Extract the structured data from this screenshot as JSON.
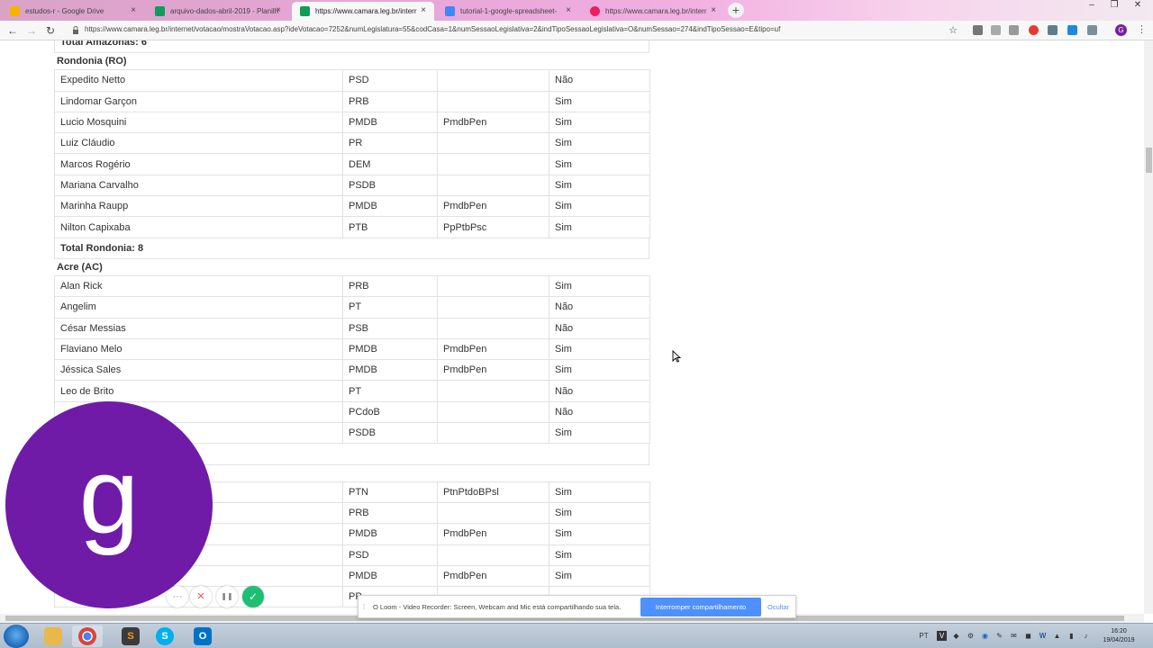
{
  "tabs": [
    {
      "label": "estudos-r - Google Drive",
      "favicon_color": "#f4b400"
    },
    {
      "label": "arquivo-dados-abril-2019 - Planilhas",
      "favicon_color": "#0f9d58"
    },
    {
      "label": "https://www.camara.leg.br/interr",
      "favicon_color": "#0f9d58"
    },
    {
      "label": "tutorial-1-google-spreadsheet-",
      "favicon_color": "#4285f4"
    },
    {
      "label": "https://www.camara.leg.br/interr",
      "favicon_color": "#e91e63"
    }
  ],
  "new_tab_symbol": "+",
  "address_bar": {
    "url": "https://www.camara.leg.br/internet/votacao/mostraVotacao.asp?ideVotacao=7252&numLegislatura=55&codCasa=1&numSessaoLegislativa=2&indTipoSessaoLegislativa=O&numSessao=274&indTipoSessao=E&tipo=uf"
  },
  "profile_initial": "G",
  "page": {
    "total_amazonas": "Total Amazonas: 6",
    "states": [
      {
        "header": "Rondonia (RO)",
        "rows": [
          {
            "name": "Expedito Netto",
            "party": "PSD",
            "bloc": "",
            "vote": "Não"
          },
          {
            "name": "Lindomar Garçon",
            "party": "PRB",
            "bloc": "",
            "vote": "Sim"
          },
          {
            "name": "Lucio Mosquini",
            "party": "PMDB",
            "bloc": "PmdbPen",
            "vote": "Sim"
          },
          {
            "name": "Luiz Cláudio",
            "party": "PR",
            "bloc": "",
            "vote": "Sim"
          },
          {
            "name": "Marcos Rogério",
            "party": "DEM",
            "bloc": "",
            "vote": "Sim"
          },
          {
            "name": "Mariana Carvalho",
            "party": "PSDB",
            "bloc": "",
            "vote": "Sim"
          },
          {
            "name": "Marinha Raupp",
            "party": "PMDB",
            "bloc": "PmdbPen",
            "vote": "Sim"
          },
          {
            "name": "Nilton Capixaba",
            "party": "PTB",
            "bloc": "PpPtbPsc",
            "vote": "Sim"
          }
        ],
        "total": "Total Rondonia: 8"
      },
      {
        "header": "Acre (AC)",
        "rows": [
          {
            "name": "Alan Rick",
            "party": "PRB",
            "bloc": "",
            "vote": "Sim"
          },
          {
            "name": "Angelim",
            "party": "PT",
            "bloc": "",
            "vote": "Não"
          },
          {
            "name": "César Messias",
            "party": "PSB",
            "bloc": "",
            "vote": "Não"
          },
          {
            "name": "Flaviano Melo",
            "party": "PMDB",
            "bloc": "PmdbPen",
            "vote": "Sim"
          },
          {
            "name": "Jéssica Sales",
            "party": "PMDB",
            "bloc": "PmdbPen",
            "vote": "Sim"
          },
          {
            "name": "Leo de Brito",
            "party": "PT",
            "bloc": "",
            "vote": "Não"
          },
          {
            "name": "",
            "party": "PCdoB",
            "bloc": "",
            "vote": "Não"
          },
          {
            "name": "",
            "party": "PSDB",
            "bloc": "",
            "vote": "Sim"
          }
        ]
      },
      {
        "rows": [
          {
            "name": "",
            "party": "PTN",
            "bloc": "PtnPtdoBPsl",
            "vote": "Sim"
          },
          {
            "name": "",
            "party": "PRB",
            "bloc": "",
            "vote": "Sim"
          },
          {
            "name": "",
            "party": "PMDB",
            "bloc": "PmdbPen",
            "vote": "Sim"
          },
          {
            "name": "",
            "party": "PSD",
            "bloc": "",
            "vote": "Sim"
          },
          {
            "name": "",
            "party": "PMDB",
            "bloc": "PmdbPen",
            "vote": "Sim"
          },
          {
            "name": "",
            "party": "PP",
            "bloc": "",
            "vote": ""
          }
        ]
      }
    ]
  },
  "loom": {
    "avatar_letter": "g",
    "more_symbol": "···",
    "cancel_symbol": "✕",
    "pause_symbol": "❚❚",
    "done_symbol": "✓"
  },
  "sharebar": {
    "message": "O Loom - Video Recorder: Screen, Webcam and Mic está compartilhando sua tela.",
    "stop_label": "Interromper compartilhamento",
    "hide_label": "Ocultar"
  },
  "taskbar": {
    "lang": "PT",
    "time": "16:20",
    "date": "19/04/2019"
  }
}
